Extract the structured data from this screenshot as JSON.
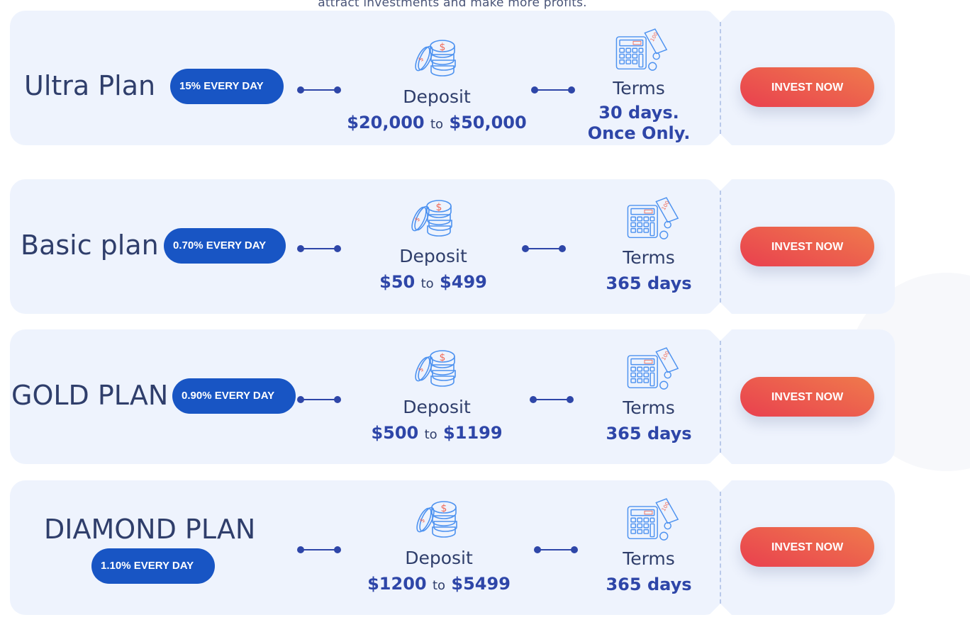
{
  "intro_text": "attract investments and make more profits.",
  "deposit_label": "Deposit",
  "terms_label": "Terms",
  "range_separator": "to",
  "invest_label": "INVEST NOW",
  "colors": {
    "card_bg": "#eef3fd",
    "badge_bg": "#1855c4",
    "accent_text": "#2e46a8",
    "heading_text": "#2f3e6b",
    "button_gradient_start": "#ef7a4c",
    "button_gradient_end": "#e9404f"
  },
  "plans": [
    {
      "name": "Ultra Plan",
      "rate": "15% EVERY DAY",
      "deposit_min": "$20,000",
      "deposit_max": "$50,000",
      "terms_line1": "30 days.",
      "terms_line2": "Once Only.",
      "icons": [
        "coins-icon",
        "calculator-icon"
      ]
    },
    {
      "name": "Basic plan",
      "rate": "0.70% EVERY DAY",
      "deposit_min": "$50",
      "deposit_max": "$499",
      "terms_line1": "365 days",
      "terms_line2": ""
    },
    {
      "name": "GOLD PLAN",
      "rate": "0.90% EVERY DAY",
      "deposit_min": "$500",
      "deposit_max": "$1199",
      "terms_line1": "365 days",
      "terms_line2": ""
    },
    {
      "name": "DIAMOND PLAN",
      "rate": "1.10% EVERY DAY",
      "deposit_min": "$1200",
      "deposit_max": "$5499",
      "terms_line1": "365 days",
      "terms_line2": ""
    }
  ]
}
